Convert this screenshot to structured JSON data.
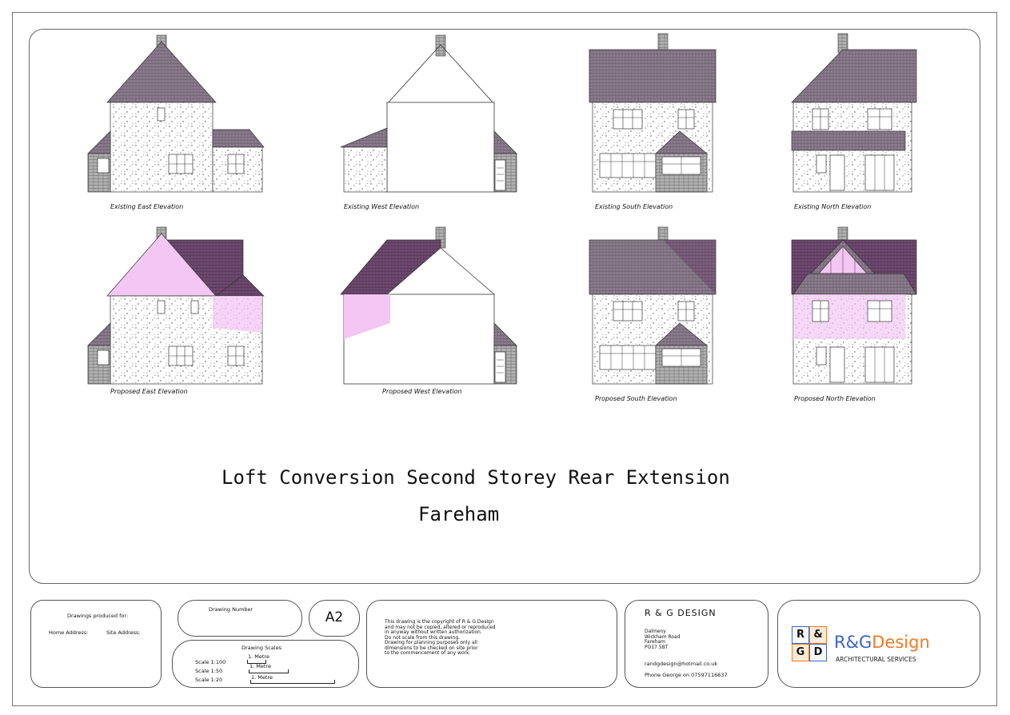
{
  "captions": {
    "existing_east": "Existing East Elevation",
    "existing_west": "Existing West Elevation",
    "existing_south": "Existing South Elevation",
    "existing_north": "Existing North Elevation",
    "proposed_east": "Proposed East Elevation",
    "proposed_west": "Proposed West Elevation",
    "proposed_south": "Proposed South Elevation",
    "proposed_north": "Proposed North Elevation"
  },
  "title": {
    "line1": "Loft Conversion Second Storey Rear Extension",
    "line2": "Fareham"
  },
  "title_block": {
    "produced_for": "Drawings produced for:",
    "home_address": "Home Address:",
    "site_address": "Site Address:",
    "drawing_number": "Drawing Number",
    "sheet_size": "A2",
    "drawing_scales": "Drawing Scales",
    "scales": [
      {
        "label": "Scale 1:100",
        "bar": "1. Metre"
      },
      {
        "label": "Scale 1:50",
        "bar": "1. Metre"
      },
      {
        "label": "Scale 1:20",
        "bar": "1. Metre"
      }
    ],
    "copyright": [
      "This drawing is the copyright of R & G Design",
      "and may not be copied, altered or reproduced",
      "in anyway without written authorization.",
      "Do not scale from this drawing.",
      "Drawing for planning purposes only all",
      "dimensions to be checked on site prior",
      "to the commencement of any work."
    ],
    "company_name": "R & G DESIGN",
    "address": [
      "Dalmeny",
      "Wickham Road",
      "Fareham",
      "PO17 5BT"
    ],
    "email": "randgdesign@hotmail.co.uk",
    "phone": "Phone George on 07597116637",
    "logo": {
      "r": "R",
      "amp": "&",
      "g": "G",
      "d": "D",
      "brand_rg": "R&G",
      "brand_design": "Design",
      "tagline": "ARCHITECTURAL SERVICES"
    }
  },
  "colors": {
    "roof": "#8c7d8e",
    "proposed_roof": "#6f4a70",
    "proposed_overlay": "#f4c6f4",
    "brick": "#a9a9a9",
    "logo_blue": "#3a64c8",
    "logo_orange": "#ee7a22"
  }
}
